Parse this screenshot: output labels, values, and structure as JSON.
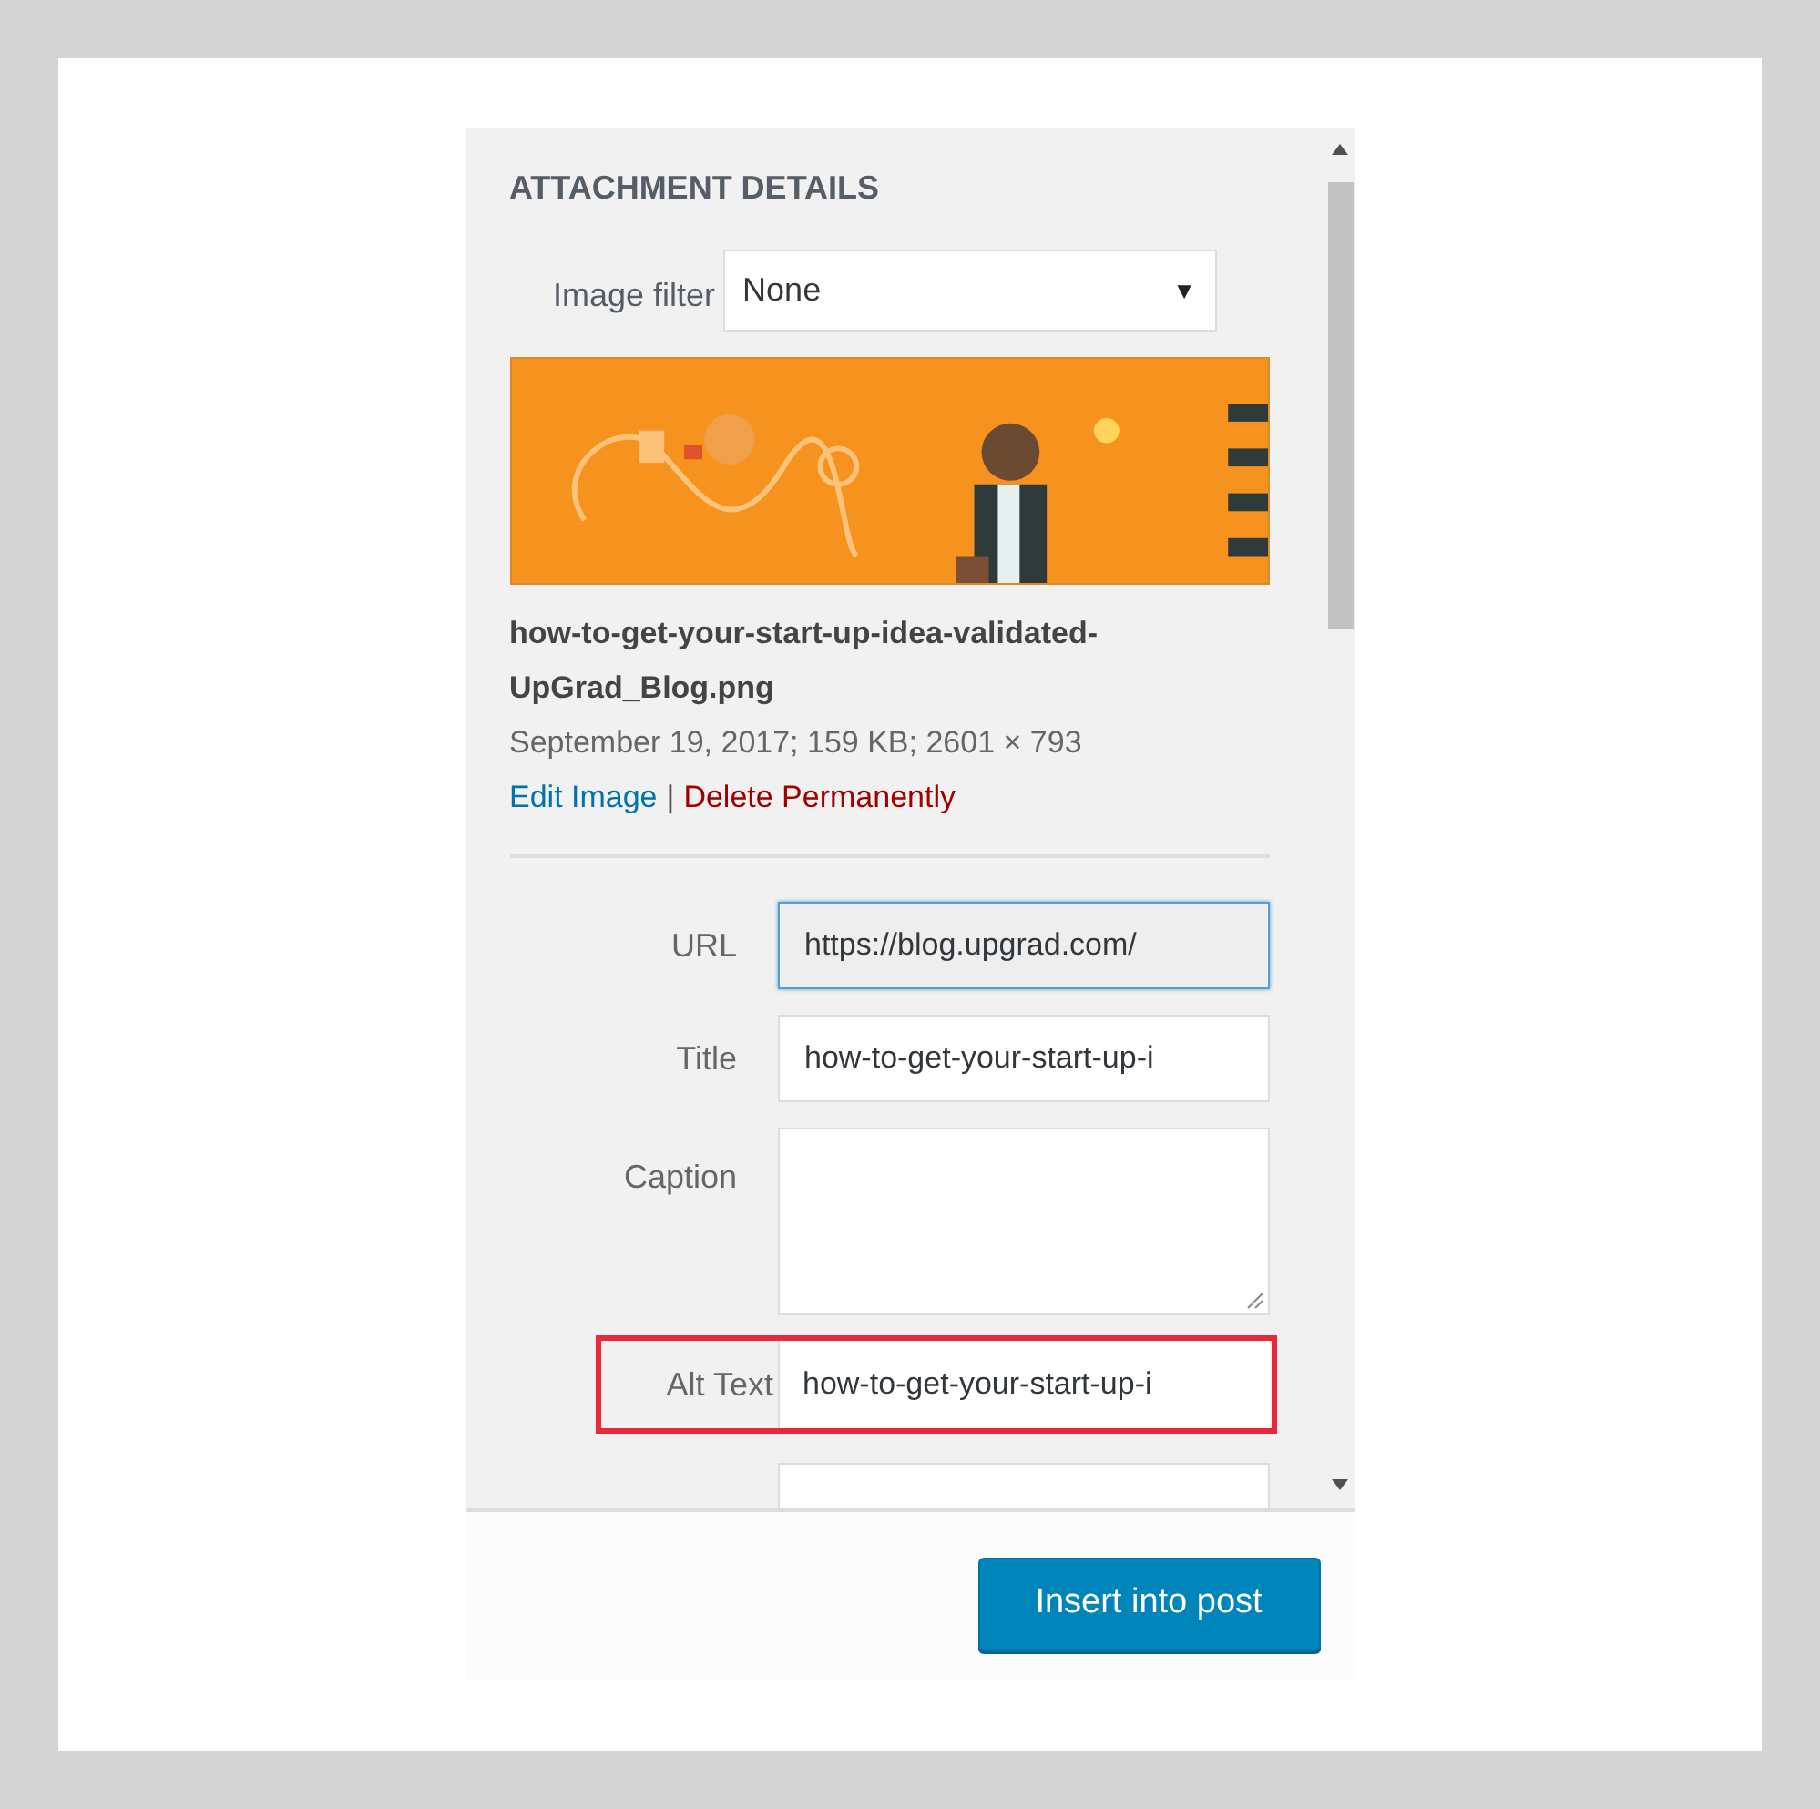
{
  "panel": {
    "heading": "ATTACHMENT DETAILS",
    "image_filter": {
      "label": "Image filter",
      "value": "None",
      "arrow": "▼"
    },
    "file_name": "how-to-get-your-start-up-idea-validated-UpGrad_Blog.png",
    "file_meta": "September 19, 2017; 159 KB; 2601 × 793",
    "links": [
      {
        "label": "Edit Image",
        "kind": "edit"
      },
      {
        "label": "Delete Permanently",
        "kind": "delete"
      }
    ],
    "link_separator": "|",
    "fields": [
      {
        "label": "URL",
        "kind": "text",
        "value": "https://blog.upgrad.com/",
        "focused": true,
        "highlighted": false
      },
      {
        "label": "Title",
        "kind": "text",
        "value": "how-to-get-your-start-up-i",
        "focused": false,
        "highlighted": false
      },
      {
        "label": "Caption",
        "kind": "textarea",
        "focused": false,
        "highlighted": false
      },
      {
        "label": "Alt Text",
        "kind": "text",
        "value": "how-to-get-your-start-up-i",
        "focused": false,
        "highlighted": true
      },
      {
        "kind": "cut"
      }
    ]
  },
  "footer": {
    "button": "Insert into post"
  }
}
